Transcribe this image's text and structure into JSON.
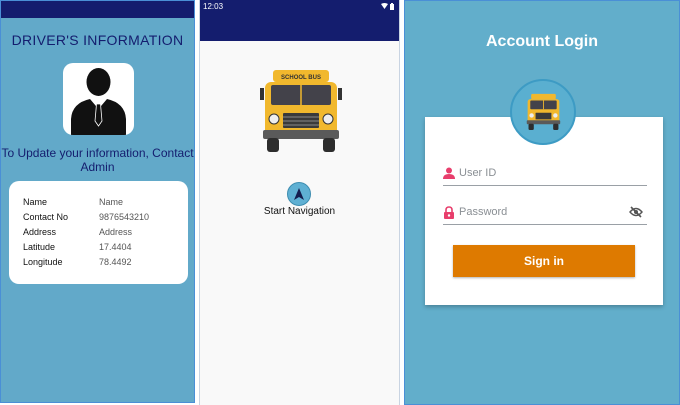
{
  "driver_screen": {
    "title": "DRIVER'S INFORMATION",
    "note": "To Update your information, Contact Admin",
    "fields": [
      {
        "label": "Name",
        "value": "Name"
      },
      {
        "label": "Contact No",
        "value": "9876543210"
      },
      {
        "label": "Address",
        "value": "Address"
      },
      {
        "label": "Latitude",
        "value": "17.4404"
      },
      {
        "label": "Longitude",
        "value": "78.4492"
      }
    ]
  },
  "navigation_screen": {
    "status_time": "12:03",
    "bus_sign": "SCHOOL BUS",
    "nav_label": "Start Navigation"
  },
  "login_screen": {
    "title": "Account Login",
    "userid_placeholder": "User ID",
    "password_placeholder": "Password",
    "signin_label": "Sign in"
  },
  "colors": {
    "panel_bg": "#62a9c9",
    "header_navy": "#141d6e",
    "signin_orange": "#de7a00",
    "icon_pink": "#e83e6c",
    "bus_yellow": "#f1b82d"
  }
}
